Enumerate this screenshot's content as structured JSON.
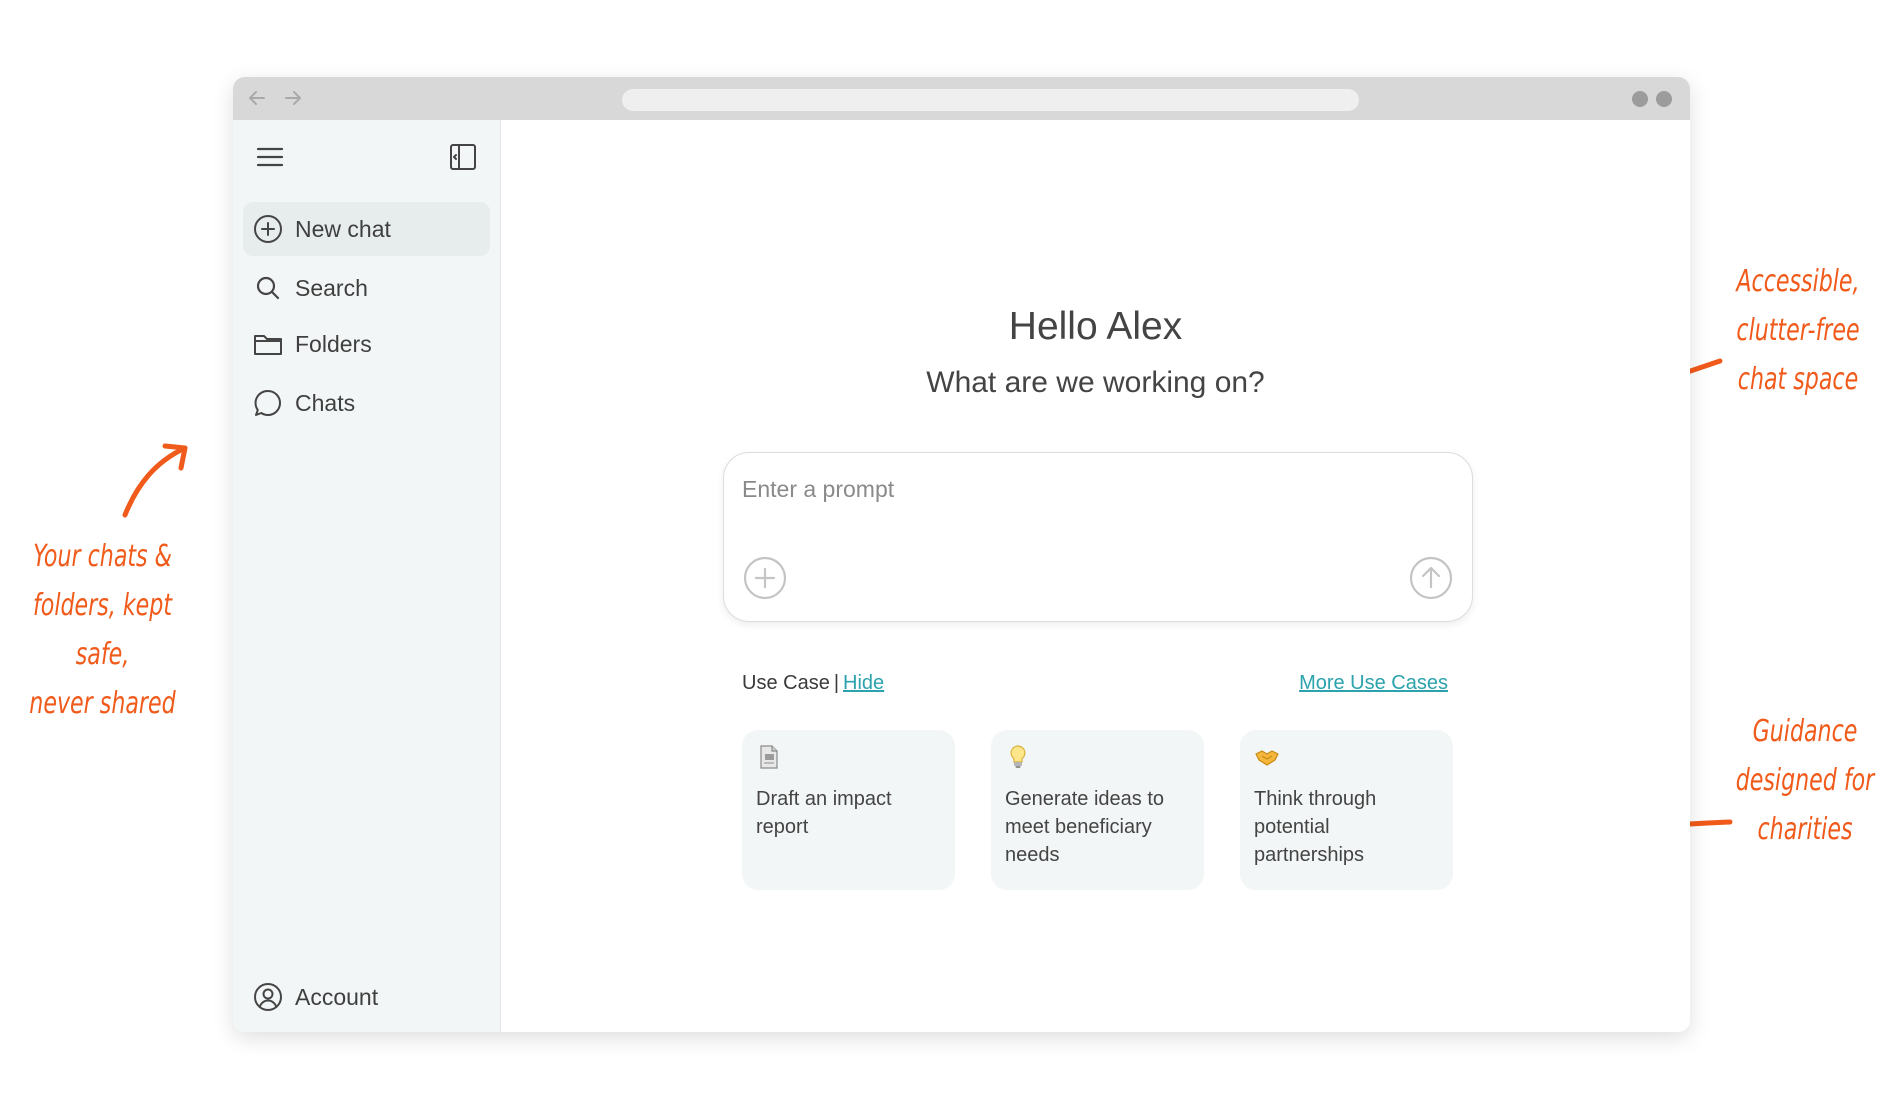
{
  "sidebar": {
    "items": [
      {
        "label": "New chat",
        "icon": "plus-circle-icon",
        "active": true
      },
      {
        "label": "Search",
        "icon": "search-icon"
      },
      {
        "label": "Folders",
        "icon": "folder-icon"
      },
      {
        "label": "Chats",
        "icon": "chat-bubble-icon"
      }
    ],
    "account_label": "Account"
  },
  "main": {
    "greeting": "Hello Alex",
    "subtitle": "What are we working on?",
    "prompt_placeholder": "Enter a prompt",
    "use_case_label": "Use Case",
    "separator": "|",
    "hide_label": "Hide",
    "more_label": "More Use Cases",
    "cards": [
      {
        "icon": "document-emoji",
        "label": "Draft an impact report"
      },
      {
        "icon": "lightbulb-emoji",
        "label": "Generate ideas to meet beneficiary needs"
      },
      {
        "icon": "handshake-emoji",
        "label": "Think through potential partnerships"
      }
    ]
  },
  "annotations": {
    "left": [
      "Your chats &",
      "folders, kept safe,",
      "never shared"
    ],
    "right_top": [
      "Accessible,",
      "clutter-free",
      "chat space"
    ],
    "right_bottom": [
      "Guidance",
      "designed for",
      "charities"
    ]
  },
  "colors": {
    "accent_link": "#2ba3ac",
    "annotation": "#f05a1a",
    "sidebar_bg": "#f3f6f6"
  }
}
